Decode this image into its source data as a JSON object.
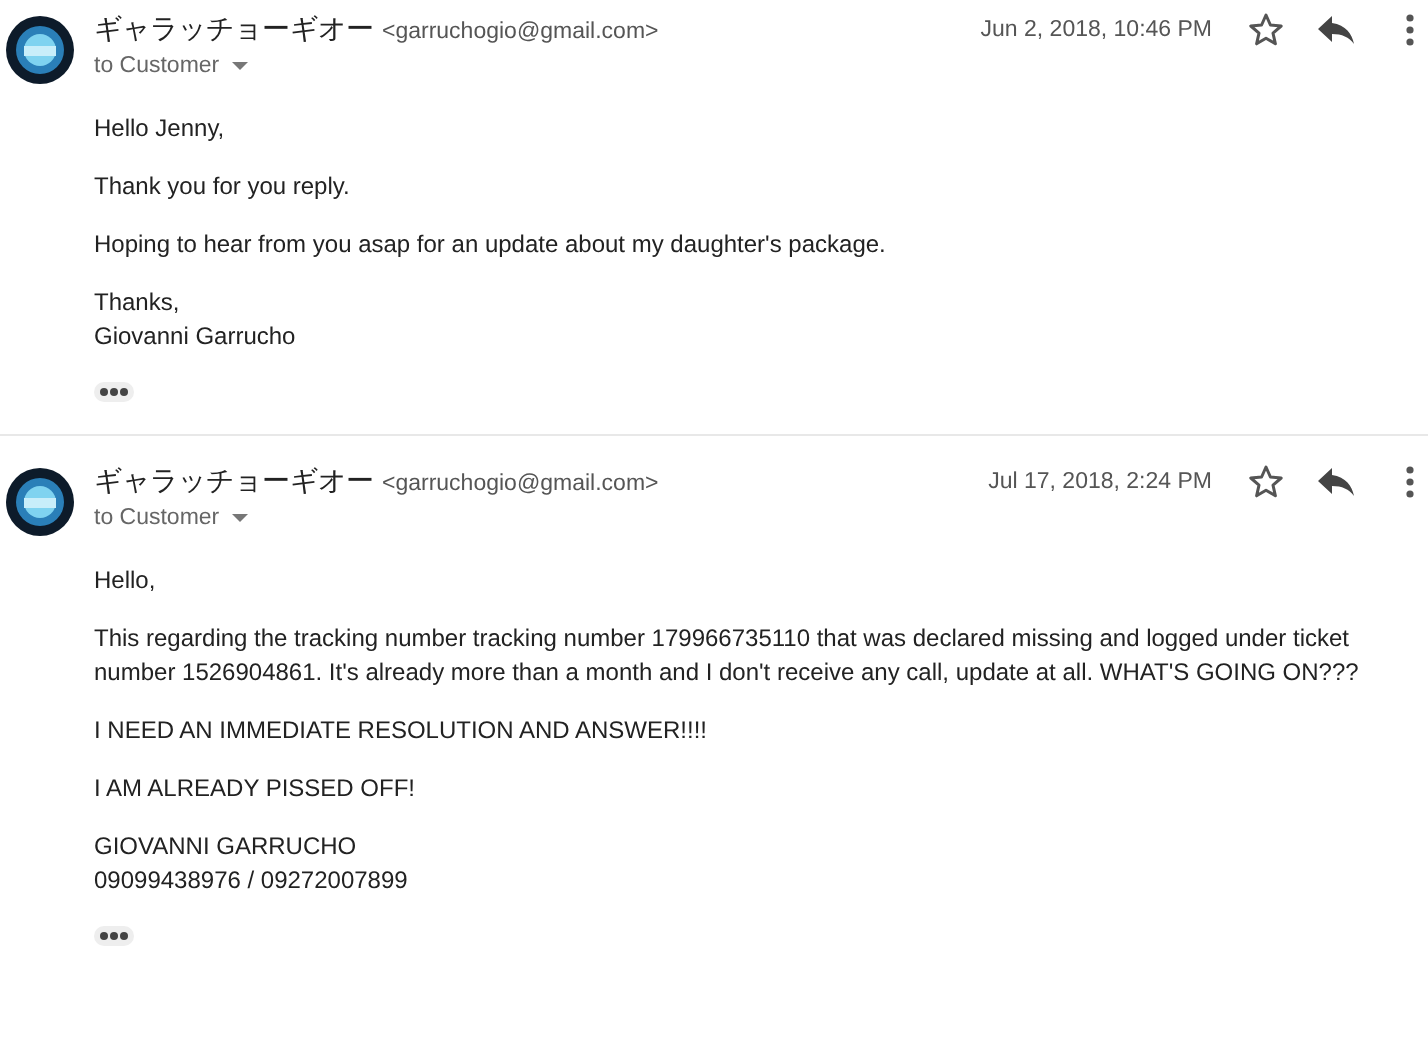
{
  "messages": [
    {
      "sender": "ギャラッチョーギオー",
      "email": "<garruchogio@gmail.com>",
      "recipient": "to Customer",
      "date": "Jun 2, 2018, 10:46 PM",
      "starred": false,
      "paragraphs": [
        [
          "Hello Jenny,"
        ],
        [
          "Thank you for you reply."
        ],
        [
          "Hoping to hear from you asap for an update about my daughter's package."
        ],
        [
          "Thanks,",
          "Giovanni Garrucho"
        ]
      ]
    },
    {
      "sender": "ギャラッチョーギオー",
      "email": "<garruchogio@gmail.com>",
      "recipient": "to Customer",
      "date": "Jul 17, 2018, 2:24 PM",
      "starred": false,
      "paragraphs": [
        [
          "Hello,"
        ],
        [
          "This regarding the tracking number tracking number 179966735110 that was declared missing and logged under ticket number 1526904861. It's already more than a month and I don't receive any call, update at all. WHAT'S GOING ON???"
        ],
        [
          "I NEED AN IMMEDIATE RESOLUTION AND ANSWER!!!!"
        ],
        [
          "I AM ALREADY PISSED OFF!"
        ],
        [
          "GIOVANNI GARRUCHO",
          "09099438976 / 09272007899"
        ]
      ]
    }
  ]
}
